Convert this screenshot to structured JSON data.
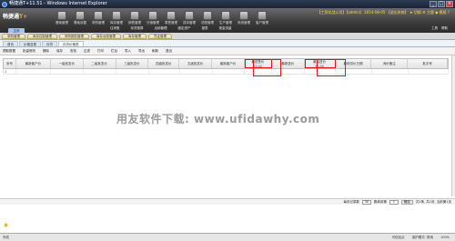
{
  "window": {
    "title": "畅捷通T+11.51 - Windows Internet Explorer",
    "buttons": [
      "_",
      "□",
      "×"
    ]
  },
  "app": {
    "logo_main": "畅捷通",
    "logo_accent": "T+",
    "user_info": "【工贸实战公司】【admin】 2014-08-05 【退出系统】 ★ 切换 ⚙ 主题 ◆ 模版 ?"
  },
  "topnav": [
    {
      "label": "基础管理"
    },
    {
      "label": "基础设置"
    },
    {
      "label": "采购管理"
    },
    {
      "label": "库存管理"
    },
    {
      "label": "销售管理"
    },
    {
      "label": "分销管理"
    },
    {
      "label": "零售管理"
    },
    {
      "label": "成本管理"
    },
    {
      "label": "总账管理"
    },
    {
      "label": "生产管理"
    },
    {
      "label": "系统管理"
    },
    {
      "label": "客户管理"
    }
  ],
  "subnav": [
    "往来账",
    "存货核算",
    "出纳管理",
    "固定资产",
    "报表",
    "现金流量"
  ],
  "rightnav": [
    "工具",
    "帮助"
  ],
  "sidebar_tab": "主页",
  "window_tabs": [
    "采购管理",
    "库存控制管理",
    "采购期初管理",
    "库存台账管理",
    "库存管理",
    "凭证管理"
  ],
  "page_tabs": [
    {
      "label": "首页",
      "active": false
    },
    {
      "label": "价格变更",
      "active": false
    },
    {
      "label": "存货",
      "active": false
    },
    {
      "label": "存货价格表",
      "active": true
    }
  ],
  "toolbar": [
    "提取数据",
    "批量修改",
    "删除",
    "保存",
    "查找",
    "过滤",
    "打印",
    "栏目",
    "导入",
    "导出",
    "刷新",
    "退出"
  ],
  "grid": {
    "columns": [
      {
        "label": "序号",
        "sub": ""
      },
      {
        "label": "最新客户价",
        "sub": ""
      },
      {
        "label": "一级批发价",
        "sub": ""
      },
      {
        "label": "二级批发价",
        "sub": ""
      },
      {
        "label": "三级批发价",
        "sub": ""
      },
      {
        "label": "四级批发价",
        "sub": ""
      },
      {
        "label": "五级批发价",
        "sub": ""
      },
      {
        "label": "最新客户价",
        "sub": ""
      },
      {
        "label": "最低售价",
        "sub": "50.00"
      },
      {
        "label": "最新进价",
        "sub": ""
      },
      {
        "label": "最高进价",
        "sub": "50.00"
      },
      {
        "label": "最低供价日期",
        "sub": ""
      },
      {
        "label": "询价备注",
        "sub": ""
      },
      {
        "label": "批次号",
        "sub": ""
      }
    ],
    "highlighted": [
      8,
      10
    ],
    "rows": [
      [
        "1",
        "",
        "",
        "",
        "",
        "",
        "",
        "",
        "",
        "",
        "",
        "",
        "",
        ""
      ]
    ]
  },
  "watermark": "用友软件下载: www.ufidawhy.com",
  "pager": {
    "records_label": "每页记录数",
    "records_value": "30",
    "page_label": "跳转到第",
    "page_value": "1",
    "confirm": "确定",
    "summary": "共1条, 共1页, 当前第1页"
  },
  "status": {
    "left": "完成",
    "right": [
      "可信站点",
      "保护模式: 禁用",
      "100%"
    ]
  }
}
